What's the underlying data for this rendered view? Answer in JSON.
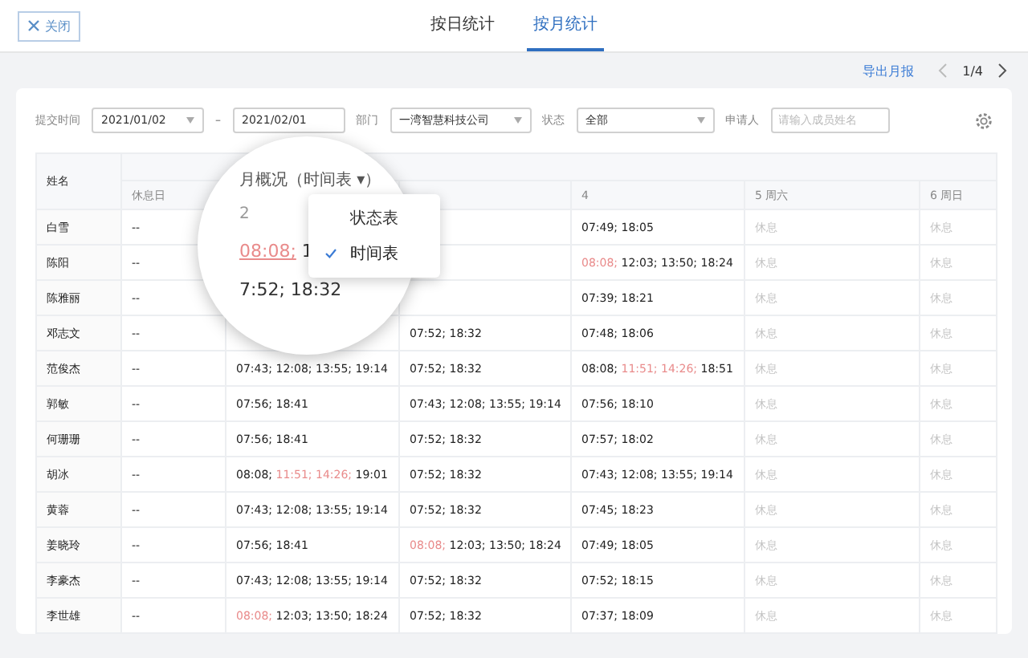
{
  "close_button": "关闭",
  "tabs": [
    {
      "label": "按日统计",
      "selected": false
    },
    {
      "label": "按月统计",
      "selected": true
    }
  ],
  "export_link": "导出月报",
  "pager": "1/4",
  "filters": {
    "date_label": "提交时间",
    "date_from": "2021/01/02",
    "date_separator": "–",
    "date_to": "2021/02/01",
    "dept_label": "部门",
    "dept": "一湾智慧科技公司",
    "status_label": "状态",
    "status": "全部",
    "applicant_label": "申请人",
    "applicant_placeholder": "请输入成员姓名"
  },
  "columns": [
    "姓名",
    "休息日"
  ],
  "day_columns": {
    "day4": "4",
    "day5": "5 周六",
    "day6": "6 周日"
  },
  "rows": [
    {
      "name": "白雪",
      "rest": "--",
      "day4": [
        {
          "t": "07:49; 18:05",
          "late": false
        }
      ],
      "day5": "休息",
      "day6": "休息"
    },
    {
      "name": "陈阳",
      "rest": "--",
      "day4": [
        {
          "t": "08:08;",
          "late": true
        },
        {
          "t": " 12:03; 13:50; 18:24",
          "late": false
        }
      ],
      "day5": "休息",
      "day6": "休息"
    },
    {
      "name": "陈雅丽",
      "rest": "--",
      "day4": [
        {
          "t": "07:39; 18:21",
          "late": false
        }
      ],
      "day5": "休息",
      "day6": "休息"
    },
    {
      "name": "邓志文",
      "rest": "--",
      "day3": [
        {
          "t": "07:52; 18:32",
          "late": false
        }
      ],
      "day4": [
        {
          "t": "07:48; 18:06",
          "late": false
        }
      ],
      "day5": "休息",
      "day6": "休息"
    },
    {
      "name": "范俊杰",
      "rest": "--",
      "day2": [
        {
          "t": "07:43; 12:08; 13:55; 19:14",
          "late": false
        }
      ],
      "day3": [
        {
          "t": "07:52; 18:32",
          "late": false
        }
      ],
      "day4": [
        {
          "t": "08:08;",
          "late": false
        },
        {
          "t": " 11:51; 14:26;",
          "late": true
        },
        {
          "t": " 18:51",
          "late": false
        }
      ],
      "day5": "休息",
      "day6": "休息"
    },
    {
      "name": "郭敏",
      "rest": "--",
      "day2": [
        {
          "t": "07:56; 18:41",
          "late": false
        }
      ],
      "day3": [
        {
          "t": "07:43; 12:08; 13:55; 19:14",
          "late": false
        }
      ],
      "day4": [
        {
          "t": "07:56; 18:10",
          "late": false
        }
      ],
      "day5": "休息",
      "day6": "休息"
    },
    {
      "name": "何珊珊",
      "rest": "--",
      "day2": [
        {
          "t": "07:56; 18:41",
          "late": false
        }
      ],
      "day3": [
        {
          "t": "07:52; 18:32",
          "late": false
        }
      ],
      "day4": [
        {
          "t": "07:57; 18:02",
          "late": false
        }
      ],
      "day5": "休息",
      "day6": "休息"
    },
    {
      "name": "胡冰",
      "rest": "--",
      "day2": [
        {
          "t": "08:08;",
          "late": false
        },
        {
          "t": " 11:51; 14:26;",
          "late": true
        },
        {
          "t": " 19:01",
          "late": false
        }
      ],
      "day3": [
        {
          "t": "07:52; 18:32",
          "late": false
        }
      ],
      "day4": [
        {
          "t": "07:43; 12:08; 13:55; 19:14",
          "late": false
        }
      ],
      "day5": "休息",
      "day6": "休息"
    },
    {
      "name": "黄蓉",
      "rest": "--",
      "day2": [
        {
          "t": "07:43; 12:08; 13:55; 19:14",
          "late": false
        }
      ],
      "day3": [
        {
          "t": "07:52; 18:32",
          "late": false
        }
      ],
      "day4": [
        {
          "t": "07:45; 18:23",
          "late": false
        }
      ],
      "day5": "休息",
      "day6": "休息"
    },
    {
      "name": "姜晓玲",
      "rest": "--",
      "day2": [
        {
          "t": "07:56; 18:41",
          "late": false
        }
      ],
      "day3": [
        {
          "t": "08:08;",
          "late": true
        },
        {
          "t": " 12:03; 13:50; 18:24",
          "late": false
        }
      ],
      "day4": [
        {
          "t": "07:49; 18:05",
          "late": false
        }
      ],
      "day5": "休息",
      "day6": "休息"
    },
    {
      "name": "李豪杰",
      "rest": "--",
      "day2": [
        {
          "t": "07:43; 12:08; 13:55; 19:14",
          "late": false
        }
      ],
      "day3": [
        {
          "t": "07:52; 18:32",
          "late": false
        }
      ],
      "day4": [
        {
          "t": "07:52; 18:15",
          "late": false
        }
      ],
      "day5": "休息",
      "day6": "休息"
    },
    {
      "name": "李世雄",
      "rest": "--",
      "day2": [
        {
          "t": "08:08;",
          "late": true
        },
        {
          "t": " 12:03; 13:50; 18:24",
          "late": false
        }
      ],
      "day3": [
        {
          "t": "07:52; 18:32",
          "late": false
        }
      ],
      "day4": [
        {
          "t": "07:37; 18:09",
          "late": false
        }
      ],
      "day5": "休息",
      "day6": "休息"
    }
  ],
  "magnifier": {
    "header": "月概况（时间表 ▾）",
    "day": "2",
    "cells": [
      [
        {
          "t": "08:08;",
          "late": true
        },
        {
          "t": " 1",
          "late": false
        }
      ],
      [
        {
          "t": "7:52; 18:32",
          "late": false
        }
      ]
    ]
  },
  "view_menu": [
    {
      "label": "状态表",
      "selected": false
    },
    {
      "label": "时间表",
      "selected": true
    }
  ]
}
